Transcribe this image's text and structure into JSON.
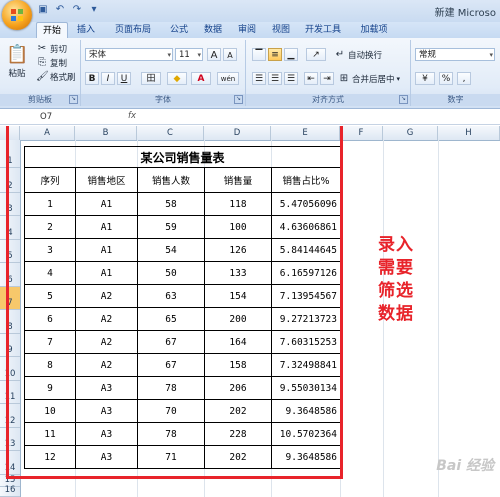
{
  "app": {
    "title": "新建 Microso"
  },
  "tabs": [
    "开始",
    "插入",
    "页面布局",
    "公式",
    "数据",
    "审阅",
    "视图",
    "开发工具",
    "加载项"
  ],
  "clipboard": {
    "paste": "粘贴",
    "cut": "剪切",
    "copy": "复制",
    "format_painter": "格式刷",
    "label": "剪贴板"
  },
  "font": {
    "name": "宋体",
    "size": "11",
    "label": "字体",
    "bold": "B",
    "italic": "I",
    "underline": "U",
    "grow": "A",
    "shrink": "A",
    "border": "田",
    "fill": "◆",
    "color": "A",
    "phonetic": "wén"
  },
  "alignment": {
    "wrap": "自动换行",
    "merge": "合并后居中",
    "label": "对齐方式"
  },
  "number": {
    "format": "常规",
    "label": "数字",
    "percent": "%",
    "comma": ","
  },
  "formula_bar": {
    "name_box": "O7",
    "fx": "fx"
  },
  "columns": [
    "A",
    "B",
    "C",
    "D",
    "E",
    "F",
    "G",
    "H"
  ],
  "rows": [
    "1",
    "2",
    "3",
    "4",
    "5",
    "6",
    "7",
    "8",
    "9",
    "10",
    "11",
    "12",
    "13",
    "14",
    "15",
    "16"
  ],
  "selected_row": "7",
  "table": {
    "title": "某公司销售量表",
    "headers": [
      "序列",
      "销售地区",
      "销售人数",
      "销售量",
      "销售占比%"
    ],
    "rows": [
      [
        "1",
        "A1",
        "58",
        "118",
        "5.47056096"
      ],
      [
        "2",
        "A1",
        "59",
        "100",
        "4.63606861"
      ],
      [
        "3",
        "A1",
        "54",
        "126",
        "5.84144645"
      ],
      [
        "4",
        "A1",
        "50",
        "133",
        "6.16597126"
      ],
      [
        "5",
        "A2",
        "63",
        "154",
        "7.13954567"
      ],
      [
        "6",
        "A2",
        "65",
        "200",
        "9.27213723"
      ],
      [
        "7",
        "A2",
        "67",
        "164",
        "7.60315253"
      ],
      [
        "8",
        "A2",
        "67",
        "158",
        "7.32498841"
      ],
      [
        "9",
        "A3",
        "78",
        "206",
        "9.55030134"
      ],
      [
        "10",
        "A3",
        "70",
        "202",
        "9.3648586"
      ],
      [
        "11",
        "A3",
        "78",
        "228",
        "10.5702364"
      ],
      [
        "12",
        "A3",
        "71",
        "202",
        "9.3648586"
      ]
    ]
  },
  "annotation": [
    "录入",
    "需要",
    "筛选",
    "数据"
  ],
  "watermark": "Bai 经验",
  "colors": {
    "highlight": "#e8232a",
    "selected_row": "#f7c86b",
    "ribbon": "#dde8f6"
  }
}
